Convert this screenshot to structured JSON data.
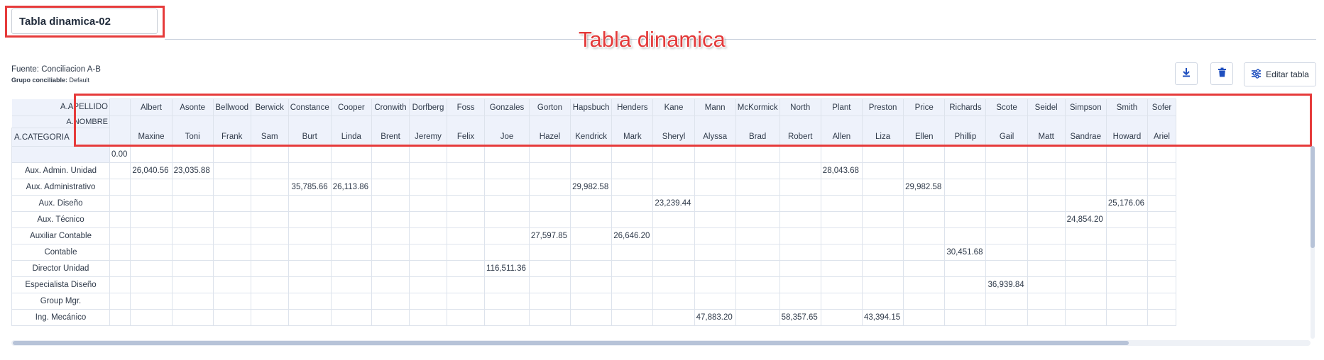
{
  "header": {
    "table_name": "Tabla dinamica-02",
    "annotation": "Tabla dinamica"
  },
  "info": {
    "source_label": "Fuente: Conciliacion A-B",
    "group_label": "Grupo conciliable:",
    "group_value": "Default"
  },
  "toolbar": {
    "download_icon": "download-icon",
    "delete_icon": "trash-icon",
    "edit_label": "Editar tabla",
    "edit_icon": "sliders-icon"
  },
  "pivot": {
    "col_field_1": "A.APELLIDO",
    "col_field_2": "A.NOMBRE",
    "row_field": "A.CATEGORIA",
    "columns": [
      {
        "apellido": "",
        "nombre": ""
      },
      {
        "apellido": "Albert",
        "nombre": "Maxine"
      },
      {
        "apellido": "Asonte",
        "nombre": "Toni"
      },
      {
        "apellido": "Bellwood",
        "nombre": "Frank"
      },
      {
        "apellido": "Berwick",
        "nombre": "Sam"
      },
      {
        "apellido": "Constance",
        "nombre": "Burt"
      },
      {
        "apellido": "Cooper",
        "nombre": "Linda"
      },
      {
        "apellido": "Cronwith",
        "nombre": "Brent"
      },
      {
        "apellido": "Dorfberg",
        "nombre": "Jeremy"
      },
      {
        "apellido": "Foss",
        "nombre": "Felix"
      },
      {
        "apellido": "Gonzales",
        "nombre": "Joe"
      },
      {
        "apellido": "Gorton",
        "nombre": "Hazel"
      },
      {
        "apellido": "Hapsbuch",
        "nombre": "Kendrick"
      },
      {
        "apellido": "Henders",
        "nombre": "Mark"
      },
      {
        "apellido": "Kane",
        "nombre": "Sheryl"
      },
      {
        "apellido": "Mann",
        "nombre": "Alyssa"
      },
      {
        "apellido": "McKormick",
        "nombre": "Brad"
      },
      {
        "apellido": "North",
        "nombre": "Robert"
      },
      {
        "apellido": "Plant",
        "nombre": "Allen"
      },
      {
        "apellido": "Preston",
        "nombre": "Liza"
      },
      {
        "apellido": "Price",
        "nombre": "Ellen"
      },
      {
        "apellido": "Richards",
        "nombre": "Phillip"
      },
      {
        "apellido": "Scote",
        "nombre": "Gail"
      },
      {
        "apellido": "Seidel",
        "nombre": "Matt"
      },
      {
        "apellido": "Simpson",
        "nombre": "Sandrae"
      },
      {
        "apellido": "Smith",
        "nombre": "Howard"
      },
      {
        "apellido": "Sofer",
        "nombre": "Ariel"
      }
    ],
    "rows": [
      {
        "label": "",
        "cells": {
          "0": "0.00"
        }
      },
      {
        "label": "Aux. Admin. Unidad",
        "cells": {
          "1": "26,040.56",
          "2": "23,035.88",
          "18": "28,043.68"
        }
      },
      {
        "label": "Aux. Administrativo",
        "cells": {
          "5": "35,785.66",
          "6": "26,113.86",
          "12": "29,982.58",
          "20": "29,982.58"
        }
      },
      {
        "label": "Aux. Diseño",
        "cells": {
          "14": "23,239.44",
          "25": "25,176.06"
        }
      },
      {
        "label": "Aux. Técnico",
        "cells": {
          "24": "24,854.20"
        }
      },
      {
        "label": "Auxiliar Contable",
        "cells": {
          "11": "27,597.85",
          "13": "26,646.20"
        }
      },
      {
        "label": "Contable",
        "cells": {
          "21": "30,451.68"
        }
      },
      {
        "label": "Director Unidad",
        "cells": {
          "10": "116,511.36"
        }
      },
      {
        "label": "Especialista Diseño",
        "cells": {
          "22": "36,939.84"
        }
      },
      {
        "label": "Group Mgr.",
        "cells": {}
      },
      {
        "label": "Ing. Mecánico",
        "cells": {
          "15": "47,883.20",
          "17": "58,357.65",
          "19": "43,394.15"
        }
      }
    ]
  },
  "colors": {
    "accent_red": "#e63b3b",
    "header_bg": "#eef2fb",
    "grid": "#dde3ec",
    "button_blue": "#1f4fbf"
  }
}
